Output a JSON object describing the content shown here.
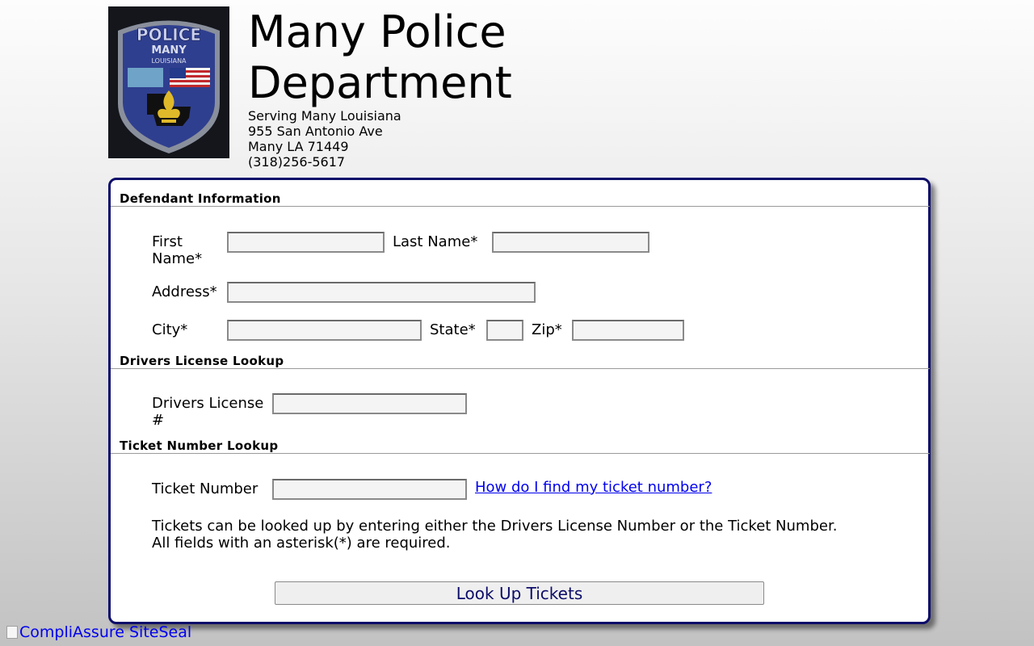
{
  "header": {
    "title": "Many Police Department",
    "tagline": "Serving Many Louisiana",
    "address": "955 San Antonio Ave",
    "city_line": "Many LA 71449",
    "phone": "(318)256-5617",
    "badge": {
      "line1": "POLICE",
      "line2": "MANY",
      "line3": "LOUISIANA",
      "color_primary": "#2f3f8f",
      "color_accent": "#e0b92a"
    }
  },
  "sections": {
    "defendant": "Defendant Information",
    "license": "Drivers License Lookup",
    "ticket": "Ticket Number Lookup"
  },
  "fields": {
    "first_name": {
      "label": "First Name*",
      "value": ""
    },
    "last_name": {
      "label": "Last Name*",
      "value": ""
    },
    "address": {
      "label": "Address*",
      "value": ""
    },
    "city": {
      "label": "City*",
      "value": ""
    },
    "state": {
      "label": "State*",
      "value": ""
    },
    "zip": {
      "label": "Zip*",
      "value": ""
    },
    "drivers_license": {
      "label": "Drivers License #",
      "value": ""
    },
    "ticket_number": {
      "label": "Ticket Number",
      "value": ""
    }
  },
  "help_link": "How do I find my ticket number?",
  "instructions": {
    "line1": "Tickets can be looked up by entering either the Drivers License Number or the Ticket Number.",
    "line2": "All fields with an asterisk(*) are required."
  },
  "submit_label": "Look Up Tickets",
  "siteseal_alt": "CompliAssure SiteSeal",
  "colors": {
    "panel_border": "#0c0c6a",
    "link": "#0000ee",
    "button_text": "#0c0c6a"
  }
}
